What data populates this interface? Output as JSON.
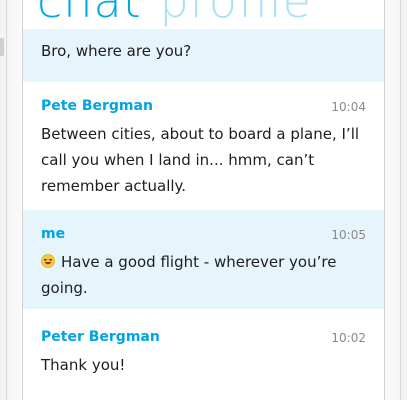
{
  "header": {
    "pivot_active": "chat",
    "pivot_inactive": "profile"
  },
  "messages": [
    {
      "sender": "",
      "time": "",
      "text": "Bro, where are you?"
    },
    {
      "sender": "Pete Bergman",
      "time": "10:04",
      "text": "Between cities, about to board a plane, I’ll call you when I land in... hmm, can’t remember actually."
    },
    {
      "sender": "me",
      "time": "10:05",
      "text": "Have a good flight - wherever you’re going.",
      "icon": "laughing-emoji-icon"
    },
    {
      "sender": "Peter Bergman",
      "time": "10:02",
      "text": "Thank you!"
    }
  ],
  "colors": {
    "accent": "#00a4e4",
    "pivot_inactive": "#aee0f5",
    "shaded_row": "#e6f4fb"
  }
}
